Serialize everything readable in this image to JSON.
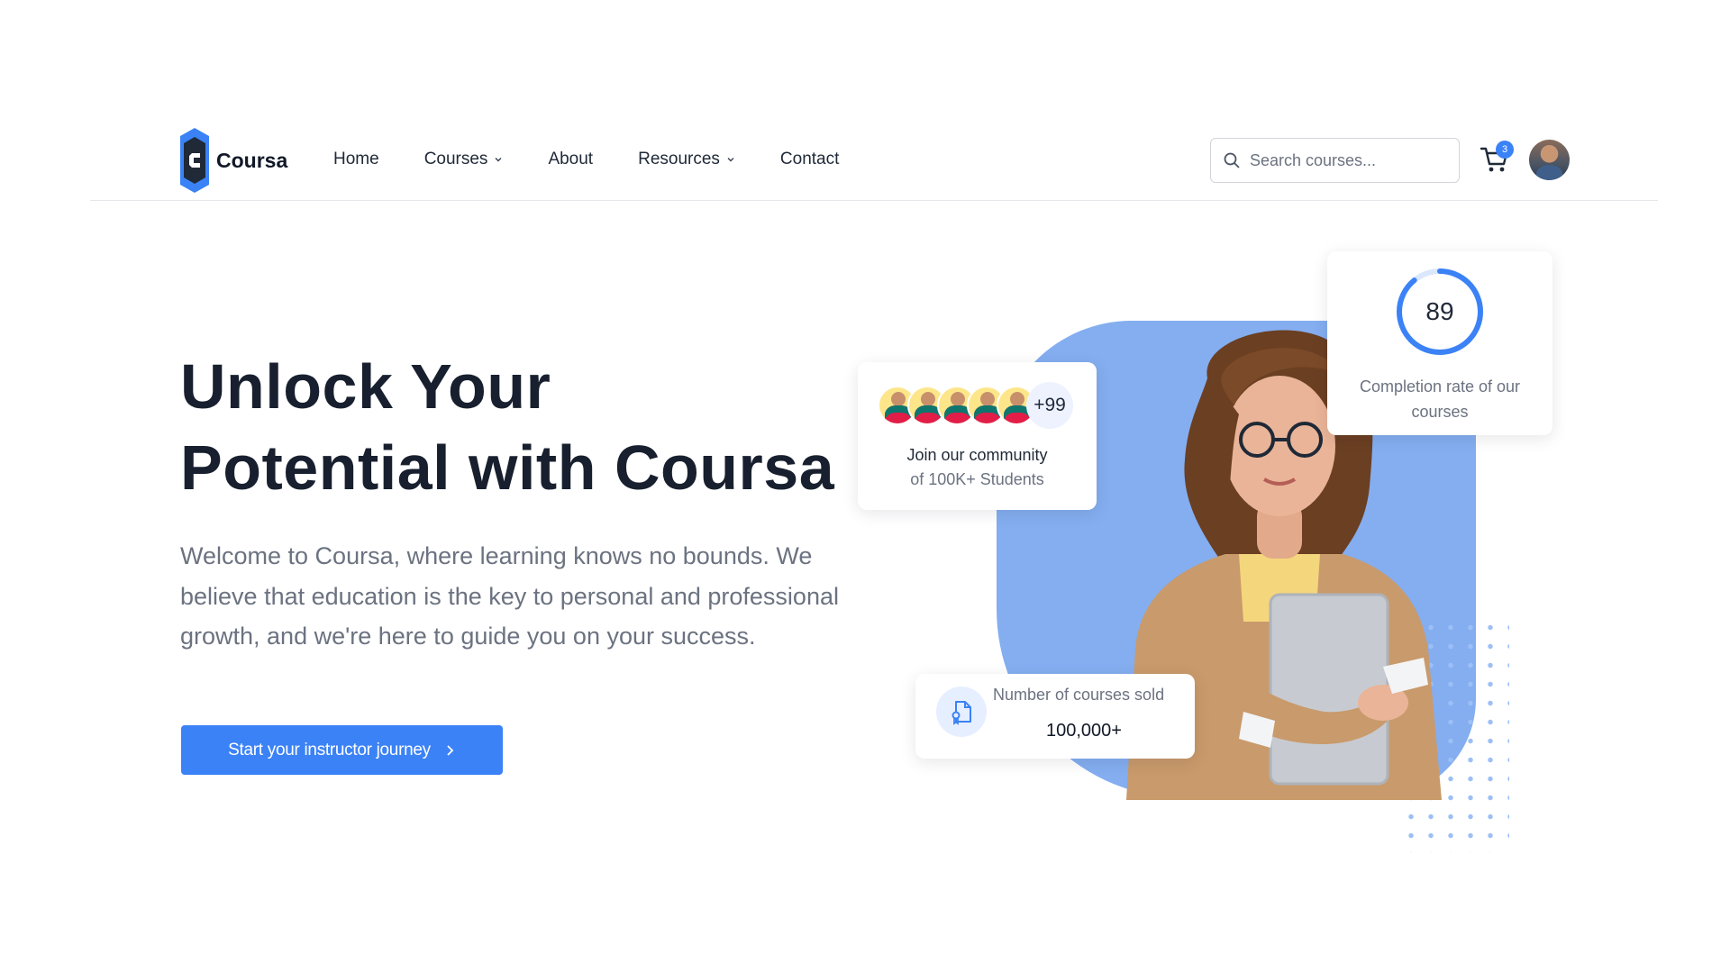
{
  "brand": {
    "name": "Coursa",
    "logo_icon": "hexagon-c-logo",
    "accent": "#3b82f6"
  },
  "nav": {
    "items": [
      {
        "label": "Home",
        "has_dropdown": false
      },
      {
        "label": "Courses",
        "has_dropdown": true
      },
      {
        "label": "About",
        "has_dropdown": false
      },
      {
        "label": "Resources",
        "has_dropdown": true
      },
      {
        "label": "Contact",
        "has_dropdown": false
      }
    ],
    "search_placeholder": "Search courses...",
    "cart_count": "3"
  },
  "hero": {
    "title_line1": "Unlock Your",
    "title_line2": "Potential with Coursa",
    "description": "Welcome to Coursa, where learning knows no bounds. We believe that education is the key to personal and professional growth, and we're here to guide you on your success.",
    "cta_label": "Start your instructor journey"
  },
  "community_card": {
    "extra_count": "+99",
    "line1": "Join our community",
    "line2": "of 100K+ Students"
  },
  "completion_card": {
    "value": "89",
    "percent": 89,
    "label": "Completion rate of our courses"
  },
  "sold_card": {
    "label": "Number of courses sold",
    "value": "100,000+"
  }
}
